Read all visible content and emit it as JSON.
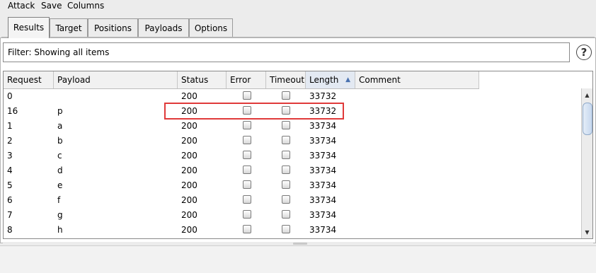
{
  "menu": {
    "attack": "Attack",
    "save": "Save",
    "columns": "Columns"
  },
  "tabs": [
    {
      "label": "Results",
      "active": true
    },
    {
      "label": "Target"
    },
    {
      "label": "Positions"
    },
    {
      "label": "Payloads"
    },
    {
      "label": "Options"
    }
  ],
  "filter": {
    "text": "Filter: Showing all items"
  },
  "help": {
    "label": "?"
  },
  "table": {
    "columns": [
      "Request",
      "Payload",
      "Status",
      "Error",
      "Timeout",
      "Length",
      "Comment"
    ],
    "sorted_column": "Length",
    "sort_direction": "ascending",
    "rows": [
      {
        "request": "0",
        "payload": "",
        "status": "200",
        "error": false,
        "timeout": false,
        "length": "33732",
        "comment": ""
      },
      {
        "request": "16",
        "payload": "p",
        "status": "200",
        "error": false,
        "timeout": false,
        "length": "33732",
        "comment": ""
      },
      {
        "request": "1",
        "payload": "a",
        "status": "200",
        "error": false,
        "timeout": false,
        "length": "33734",
        "comment": ""
      },
      {
        "request": "2",
        "payload": "b",
        "status": "200",
        "error": false,
        "timeout": false,
        "length": "33734",
        "comment": ""
      },
      {
        "request": "3",
        "payload": "c",
        "status": "200",
        "error": false,
        "timeout": false,
        "length": "33734",
        "comment": ""
      },
      {
        "request": "4",
        "payload": "d",
        "status": "200",
        "error": false,
        "timeout": false,
        "length": "33734",
        "comment": ""
      },
      {
        "request": "5",
        "payload": "e",
        "status": "200",
        "error": false,
        "timeout": false,
        "length": "33734",
        "comment": ""
      },
      {
        "request": "6",
        "payload": "f",
        "status": "200",
        "error": false,
        "timeout": false,
        "length": "33734",
        "comment": ""
      },
      {
        "request": "7",
        "payload": "g",
        "status": "200",
        "error": false,
        "timeout": false,
        "length": "33734",
        "comment": ""
      },
      {
        "request": "8",
        "payload": "h",
        "status": "200",
        "error": false,
        "timeout": false,
        "length": "33734",
        "comment": ""
      }
    ]
  },
  "highlight": {
    "row_index": 1,
    "color": "#e03a3a"
  },
  "icons": {
    "sort": "sort-ascending-icon",
    "scroll_up": "scroll-up-icon",
    "scroll_down": "scroll-down-icon",
    "help": "help-icon"
  }
}
